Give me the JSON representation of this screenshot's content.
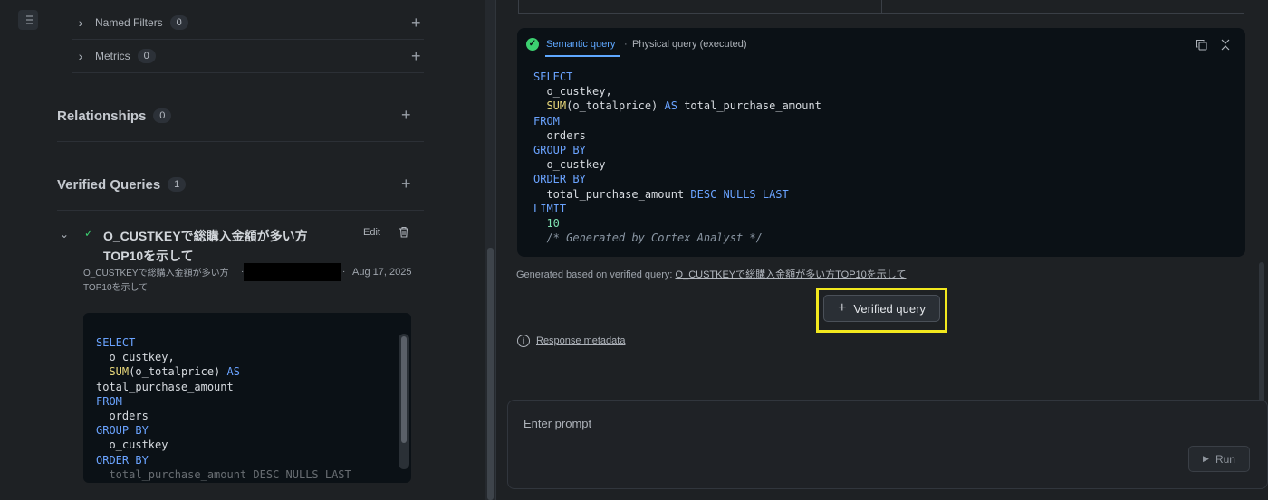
{
  "left_panel": {
    "sub_items": [
      {
        "label": "Named Filters",
        "count": "0"
      },
      {
        "label": "Metrics",
        "count": "0"
      }
    ],
    "sections": [
      {
        "title": "Relationships",
        "count": "0"
      },
      {
        "title": "Verified Queries",
        "count": "1"
      }
    ],
    "verified_query": {
      "title": "O_CUSTKEYで総購入金額が多い方TOP10を示して",
      "edit_label": "Edit",
      "description": "O_CUSTKEYで総購入金額が多い方TOP10を示して",
      "separator": "·",
      "date": "Aug 17, 2025",
      "sql_lines": [
        "SELECT",
        "  o_custkey,",
        "  SUM(o_totalprice) AS",
        "total_purchase_amount",
        "FROM",
        "  orders",
        "GROUP BY",
        "  o_custkey",
        "ORDER BY",
        "  total_purchase_amount DESC NULLS LAST"
      ]
    }
  },
  "right_panel": {
    "tabs": {
      "semantic": "Semantic query",
      "separator": "·",
      "physical": "Physical query (executed)"
    },
    "sql_lines": [
      "SELECT",
      "  o_custkey,",
      "  SUM(o_totalprice) AS total_purchase_amount",
      "FROM",
      "  orders",
      "GROUP BY",
      "  o_custkey",
      "ORDER BY",
      "  total_purchase_amount DESC NULLS LAST",
      "LIMIT",
      "  10",
      "  /* Generated by Cortex Analyst */"
    ],
    "generated_prefix": "Generated based on verified query: ",
    "generated_link": "O_CUSTKEYで総購入金額が多い方TOP10を示して",
    "verified_query_button": "Verified query",
    "response_metadata": "Response metadata",
    "prompt_placeholder": "Enter prompt",
    "run_label": "Run"
  },
  "icons": {
    "rail": "list-icon",
    "chevron": "chevron-right-icon",
    "plus": "plus-icon",
    "check": "check-icon",
    "trash": "trash-icon",
    "copy": "copy-icon",
    "collapse": "collapse-icon",
    "info": "info-icon",
    "play": "play-icon"
  },
  "colors": {
    "accent_blue": "#5fa8ff",
    "success_green": "#3ccf70",
    "highlight_yellow": "#f2e81e",
    "code_bg": "#0b1116"
  }
}
